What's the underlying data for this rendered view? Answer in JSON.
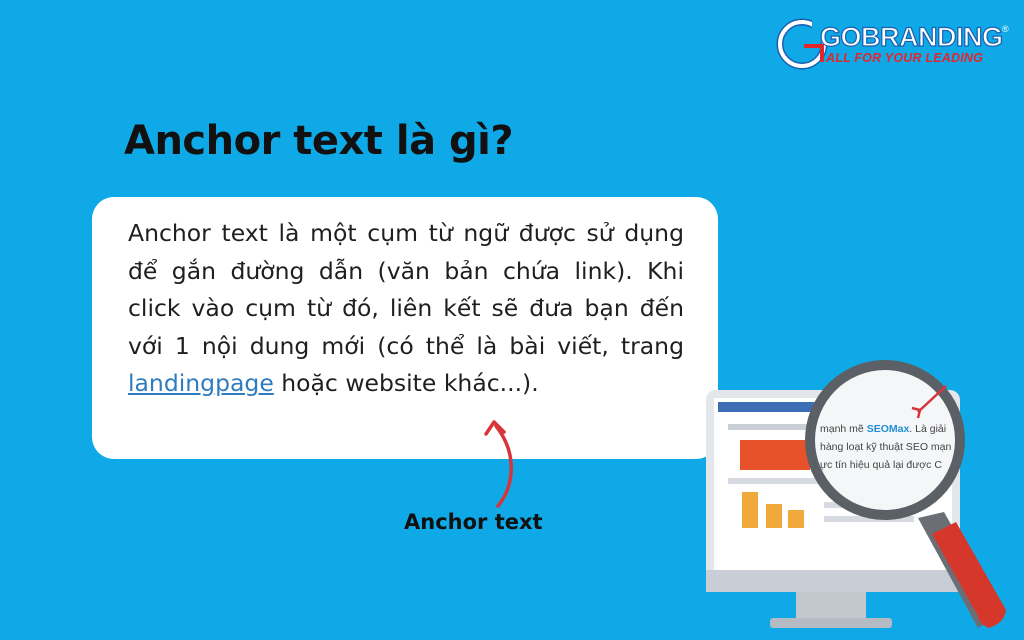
{
  "logo": {
    "brand": "GOBRANDING",
    "tagline": "ALL FOR YOUR LEADING",
    "registered": "®"
  },
  "heading": "Anchor text là gì?",
  "card": {
    "before": "Anchor text là một cụm từ ngữ được sử dụng để gắn đường dẫn (văn bản chứa link). Khi click vào cụm từ đó, liên kết sẽ đưa bạn đến với 1 nội dung mới (có thể là bài viết, trang ",
    "link": "landingpage",
    "after": " hoặc website khác...)."
  },
  "annotation": {
    "label": "Anchor text"
  },
  "magnifier_lines": [
    {
      "text": "mạnh mẽ ",
      "highlight": "SEOMax",
      "rest": ". Là giải"
    },
    {
      "text": "hàng loạt kỹ thuật SEO mạn"
    },
    {
      "text": "ực tín hiệu quả lại được C"
    }
  ],
  "colors": {
    "background": "#0fa9e8",
    "card": "#ffffff",
    "link": "#2f7cc0",
    "arrow": "#d8343a",
    "brand_red": "#e3262d"
  }
}
